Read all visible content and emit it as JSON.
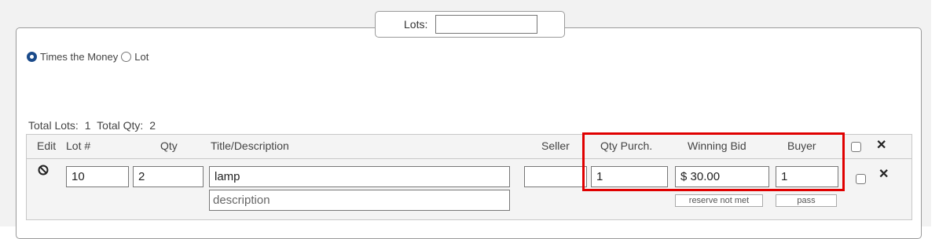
{
  "lots_filter": {
    "label": "Lots:",
    "value": ""
  },
  "mode": {
    "options": [
      {
        "label": "Times the Money",
        "selected": true
      },
      {
        "label": "Lot",
        "selected": false
      }
    ]
  },
  "totals": {
    "lots_label": "Total Lots:",
    "lots_value": "1",
    "qty_label": "Total Qty:",
    "qty_value": "2"
  },
  "table": {
    "headers": {
      "edit": "Edit",
      "lot": "Lot #",
      "qty": "Qty",
      "title": "Title/Description",
      "seller": "Seller",
      "qty_purch": "Qty Purch.",
      "winning_bid": "Winning Bid",
      "buyer": "Buyer"
    },
    "rows": [
      {
        "lot": "10",
        "qty": "2",
        "title": "lamp",
        "description_placeholder": "description",
        "seller": "",
        "qty_purch": "1",
        "winning_bid": "$ 30.00",
        "buyer": "1",
        "reserve_button": "reserve not met",
        "pass_button": "pass"
      }
    ]
  },
  "colors": {
    "highlight": "#e00000",
    "radio_selected": "#1a4a8a"
  },
  "icons": {
    "edit": "ban-icon",
    "delete": "close-icon"
  }
}
